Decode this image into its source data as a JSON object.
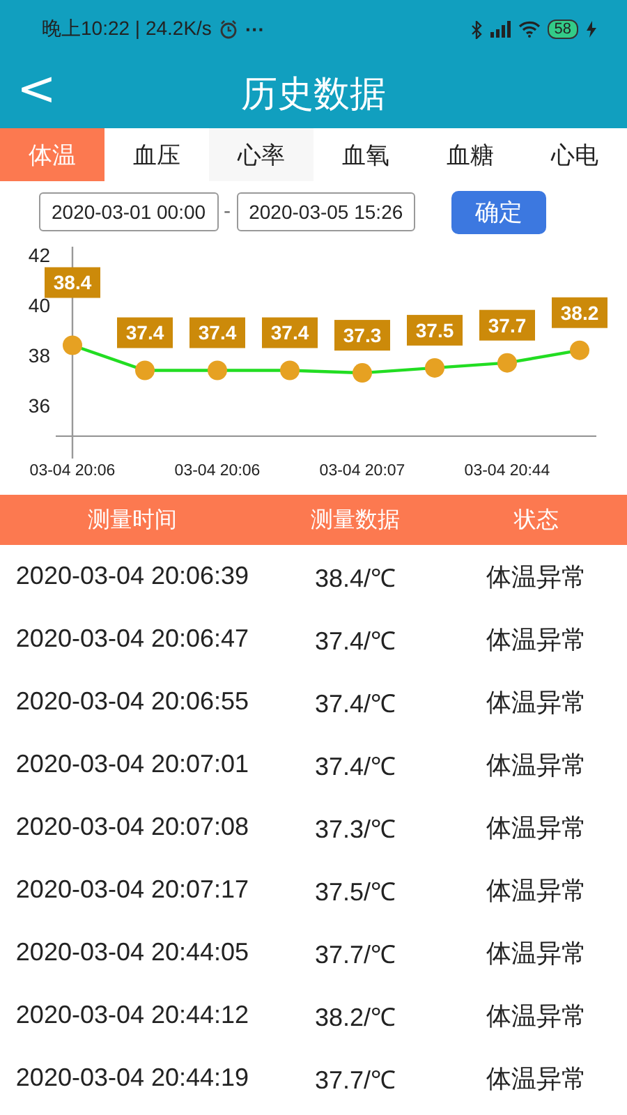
{
  "status_bar": {
    "time": "晚上10:22 | 24.2K/s",
    "more": "···",
    "battery": "58"
  },
  "header": {
    "back": "<",
    "title": "历史数据"
  },
  "tabs": [
    {
      "label": "体温",
      "selected": true
    },
    {
      "label": "血压",
      "selected": false
    },
    {
      "label": "心率",
      "selected": false
    },
    {
      "label": "血氧",
      "selected": false
    },
    {
      "label": "血糖",
      "selected": false
    },
    {
      "label": "心电",
      "selected": false
    }
  ],
  "date_range": {
    "start": "2020-03-01 00:00",
    "separator": "-",
    "end": "2020-03-05 15:26",
    "confirm": "确定"
  },
  "chart": {
    "chart_data": {
      "type": "line",
      "categories": [
        "03-04 20:06",
        null,
        "03-04 20:06",
        null,
        "03-04 20:07",
        null,
        "03-04 20:44",
        null
      ],
      "ylim": [
        35,
        42.33
      ],
      "yticks": [
        36,
        38,
        40,
        42
      ],
      "series": [
        {
          "color": "#22dd22",
          "marker": "o",
          "values": [
            38.4,
            37.4,
            37.4,
            37.4,
            37.3,
            37.5,
            37.7,
            38.2
          ]
        }
      ],
      "data_labels": true
    }
  },
  "table": {
    "columns": [
      "测量时间",
      "测量数据",
      "状态"
    ],
    "rows": [
      [
        "2020-03-04 20:06:39",
        "38.4/℃",
        "体温异常"
      ],
      [
        "2020-03-04 20:06:47",
        "37.4/℃",
        "体温异常"
      ],
      [
        "2020-03-04 20:06:55",
        "37.4/℃",
        "体温异常"
      ],
      [
        "2020-03-04 20:07:01",
        "37.4/℃",
        "体温异常"
      ],
      [
        "2020-03-04 20:07:08",
        "37.3/℃",
        "体温异常"
      ],
      [
        "2020-03-04 20:07:17",
        "37.5/℃",
        "体温异常"
      ],
      [
        "2020-03-04 20:44:05",
        "37.7/℃",
        "体温异常"
      ],
      [
        "2020-03-04 20:44:12",
        "38.2/℃",
        "体温异常"
      ],
      [
        "2020-03-04 20:44:19",
        "37.7/℃",
        "体温异常"
      ]
    ]
  }
}
